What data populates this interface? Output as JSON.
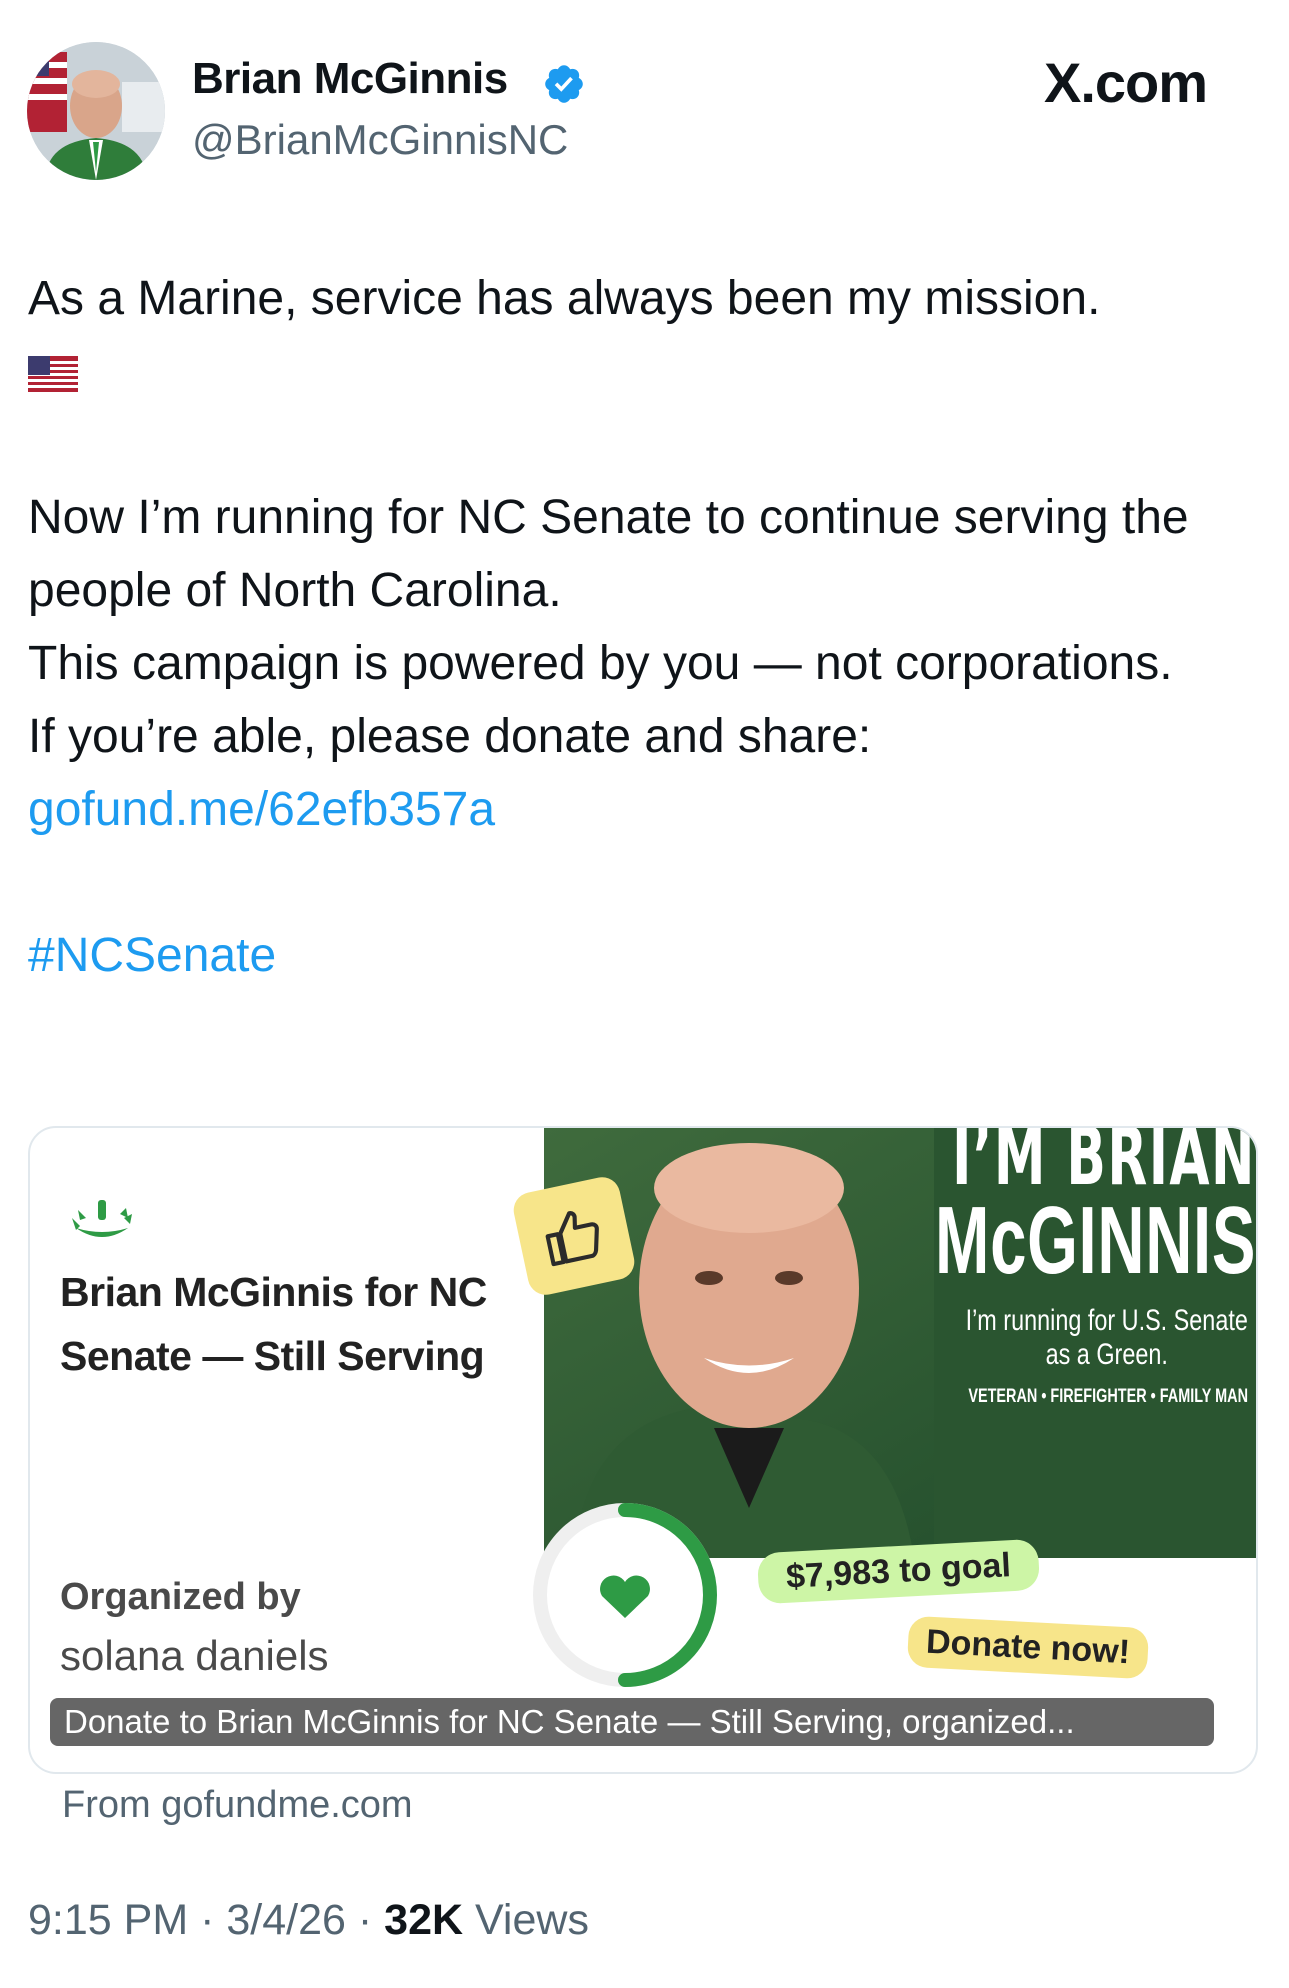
{
  "author": {
    "display_name": "Brian McGinnis",
    "handle": "@BrianMcGinnisNC",
    "verified": true,
    "avatar_icon": "profile-photo"
  },
  "brand": "X.com",
  "tweet": {
    "line1": "As a Marine, service has always been my mission.",
    "flag_icon": "us-flag-icon",
    "para2_line1": "Now I’m running for NC Senate to continue serving the people of North Carolina.",
    "para2_line2": "This campaign is powered by you — not corporations.",
    "para2_line3": "If you’re able, please donate and share:",
    "link": "gofund.me/62efb357a",
    "hashtag": "#NCSenate"
  },
  "card": {
    "campaign_title": "Brian McGinnis for NC Senate — Still Serving",
    "organized_label": "Organized by",
    "organizer": "solana daniels",
    "headline_1": "I’M BRIAN",
    "headline_2": "McGINNIS",
    "tagline_1": "I’m running for U.S. Senate",
    "tagline_2": "as a Green.",
    "credentials": "VETERAN • FIREFIGHTER • FAMILY MAN",
    "goal_text": "$7,983 to goal",
    "donate_text": "Donate now!",
    "caption": "Donate to Brian McGinnis for NC Senate — Still Serving, organized...",
    "source": "From gofundme.com",
    "colors": {
      "green": "#2e7d32",
      "pill_green": "#cdf5a6",
      "pill_yellow": "#f7e58a"
    }
  },
  "meta": {
    "time": "9:15 PM",
    "date": "3/4/26",
    "views_count": "32K",
    "views_label": "Views"
  },
  "colors": {
    "link": "#1d9bf0",
    "secondary": "#536471",
    "text": "#0f1419"
  }
}
